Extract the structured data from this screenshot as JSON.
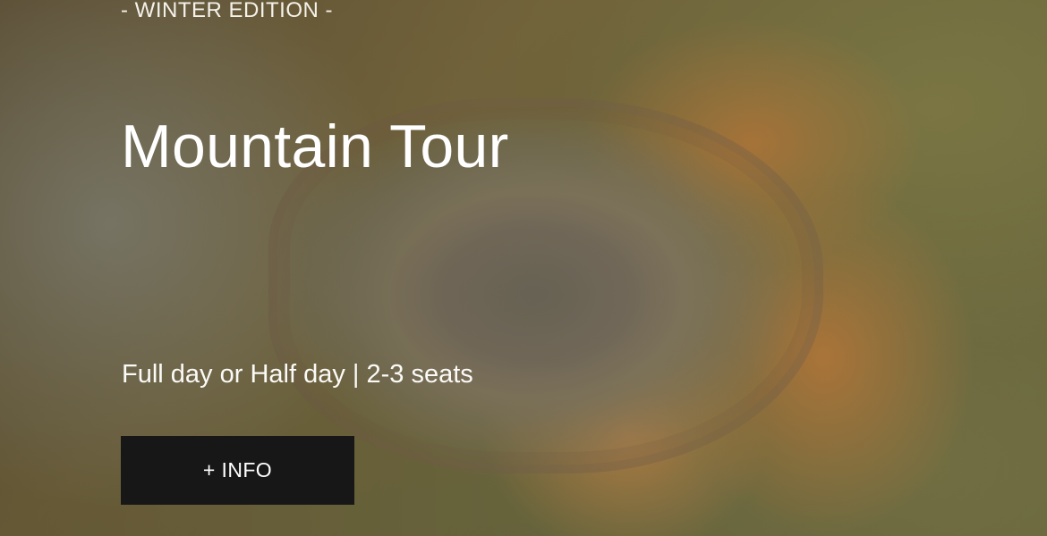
{
  "hero": {
    "edition_label": "- WINTER EDITION -",
    "title": "Mountain Tour",
    "subtitle": "Full day or Half day | 2-3 seats",
    "info_button_label": "+ INFO"
  }
}
